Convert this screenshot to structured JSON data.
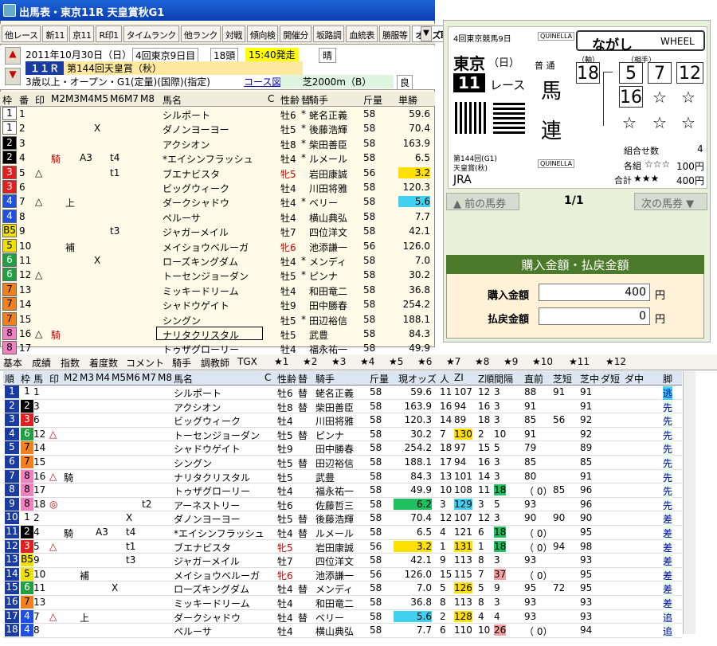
{
  "window": {
    "title": "出馬表・東京11R 天皇賞秋G1"
  },
  "toolbar": [
    "他レース",
    "新11",
    "京11",
    "R印1",
    "タイムランク",
    "他ランク",
    "対戦",
    "傾向検",
    "開催分",
    "坂路調",
    "血統表",
    "勝服等",
    "オッズ取"
  ],
  "race": {
    "date": "2011年10月30日（日）",
    "meeting": "4回東京9日目",
    "heads": "18頭",
    "post_time": "15:40発走",
    "weather": "晴",
    "race_no": "１１Ｒ",
    "name": "第144回天皇賞（秋）",
    "conditions": "3歳以上・オープン・G1(定量)(国際)(指定)",
    "course_label": "コース図",
    "course": "芝2000m（B）",
    "going": "良"
  },
  "entry_headers": [
    "枠",
    "番",
    "印",
    "M2",
    "M3",
    "M4",
    "M5",
    "M6",
    "M7",
    "M8",
    "馬名",
    "C",
    "性齢",
    "替",
    "騎手",
    "斤量",
    "単勝"
  ],
  "entries": [
    [
      "1",
      "1",
      "",
      "",
      "",
      "",
      "",
      "",
      "",
      "",
      "シルポート",
      "",
      "牡6",
      "*",
      "蛯名正義",
      "58",
      "59.6"
    ],
    [
      "1",
      "2",
      "",
      "",
      "",
      "",
      "X",
      "",
      "",
      "",
      "ダノンヨーヨー",
      "",
      "牡5",
      "*",
      "後藤浩輝",
      "58",
      "70.4"
    ],
    [
      "2",
      "3",
      "",
      "",
      "",
      "",
      "",
      "",
      "",
      "",
      "アクシオン",
      "",
      "牡8",
      "*",
      "柴田善臣",
      "58",
      "163.9"
    ],
    [
      "2",
      "4",
      "",
      "騎",
      "",
      "A3",
      "",
      "t4",
      "",
      "",
      "*エイシンフラッシュ",
      "",
      "牡4",
      "*",
      "ルメール",
      "58",
      "6.5"
    ],
    [
      "3",
      "5",
      "△",
      "",
      "",
      "",
      "",
      "t1",
      "",
      "",
      "ブエナビスタ",
      "",
      "牝5",
      "",
      "岩田康誠",
      "56",
      "3.2"
    ],
    [
      "3",
      "6",
      "",
      "",
      "",
      "",
      "",
      "",
      "",
      "",
      "ビッグウィーク",
      "",
      "牡4",
      "",
      "川田将雅",
      "58",
      "120.3"
    ],
    [
      "4",
      "7",
      "△",
      "",
      "上",
      "",
      "",
      "",
      "",
      "",
      "ダークシャドウ",
      "",
      "牡4",
      "*",
      "ベリー",
      "58",
      "5.6"
    ],
    [
      "4",
      "8",
      "",
      "",
      "",
      "",
      "",
      "",
      "",
      "",
      "ペルーサ",
      "",
      "牡4",
      "",
      "横山典弘",
      "58",
      "7.7"
    ],
    [
      "B5",
      "9",
      "",
      "",
      "",
      "",
      "",
      "t3",
      "",
      "",
      "ジャガーメイル",
      "",
      "牡7",
      "",
      "四位洋文",
      "58",
      "42.1"
    ],
    [
      "5",
      "10",
      "",
      "",
      "補",
      "",
      "",
      "",
      "",
      "",
      "メイショウベルーガ",
      "",
      "牝6",
      "",
      "池添謙一",
      "56",
      "126.0"
    ],
    [
      "6",
      "11",
      "",
      "",
      "",
      "",
      "X",
      "",
      "",
      "",
      "ローズキングダム",
      "",
      "牡4",
      "*",
      "メンディ",
      "58",
      "7.0"
    ],
    [
      "6",
      "12",
      "△",
      "",
      "",
      "",
      "",
      "",
      "",
      "",
      "トーセンジョーダン",
      "",
      "牡5",
      "*",
      "ピンナ",
      "58",
      "30.2"
    ],
    [
      "7",
      "13",
      "",
      "",
      "",
      "",
      "",
      "",
      "",
      "",
      "ミッキードリーム",
      "",
      "牡4",
      "",
      "和田竜二",
      "58",
      "36.8"
    ],
    [
      "7",
      "14",
      "",
      "",
      "",
      "",
      "",
      "",
      "",
      "",
      "シャドウゲイト",
      "",
      "牡9",
      "",
      "田中勝春",
      "58",
      "254.2"
    ],
    [
      "7",
      "15",
      "",
      "",
      "",
      "",
      "",
      "",
      "",
      "",
      "シングン",
      "",
      "牡5",
      "*",
      "田辺裕信",
      "58",
      "188.1"
    ],
    [
      "8",
      "16",
      "△",
      "騎",
      "",
      "",
      "",
      "",
      "",
      "",
      "ナリタクリスタル",
      "",
      "牡5",
      "",
      "武豊",
      "58",
      "84.3"
    ],
    [
      "8",
      "17",
      "",
      "",
      "",
      "",
      "",
      "",
      "",
      "",
      "トゥザグローリー",
      "",
      "牡4",
      "",
      "福永祐一",
      "58",
      "49.9"
    ],
    [
      "8",
      "18",
      "◎",
      "",
      "",
      "",
      "",
      "t2",
      "",
      "",
      "アーネストリー",
      "",
      "牡6",
      "",
      "佐藤哲三",
      "58",
      "6.2"
    ]
  ],
  "ticket": {
    "meeting": "4回東京競馬9日",
    "kind_top": "QUINELLA",
    "mode": "ながし",
    "mode_en": "WHEEL",
    "venue": "東京",
    "day": "（日）",
    "race_no": "11",
    "race_word": "レース",
    "type_small": "普 通",
    "type1": "馬",
    "type2": "連",
    "axis_label": "（軸）",
    "partner_label": "（相手）",
    "axis": "18",
    "partners": [
      "5",
      "7",
      "12",
      "16"
    ],
    "stars": [
      "☆",
      "☆",
      "☆",
      "☆",
      "☆"
    ],
    "race_small1": "第144回(G1)",
    "race_small2": "天皇賞(秋)",
    "jra": "JRA",
    "kind_bottom": "QUINELLA",
    "combos_label": "組合せ数",
    "combos": "4",
    "each_label": "各組",
    "each_stars": "☆☆☆",
    "each_amount": "100円",
    "total_label": "合計",
    "total_stars": "★★★",
    "total_amount": "400円"
  },
  "nav": {
    "prev": "前の馬券",
    "page": "1/1",
    "next": "次の馬券"
  },
  "payment": {
    "header": "購入金額・払戻金額",
    "buy_label": "購入金額",
    "buy_value": "400",
    "pay_label": "払戻金額",
    "pay_value": "0",
    "yen": "円"
  },
  "tabs": [
    "基本",
    "成績",
    "指数",
    "着度数",
    "コメント",
    "騎手",
    "調教師",
    "TGX",
    "★1",
    "★2",
    "★3",
    "★4",
    "★5",
    "★6",
    "★7",
    "★8",
    "★9",
    "★10",
    "★11",
    "★12"
  ],
  "bottom_headers": [
    "順",
    "枠",
    "馬",
    "印",
    "M2",
    "M3",
    "M4",
    "M5",
    "M6",
    "M7",
    "M8",
    "馬名",
    "C",
    "性齢",
    "替",
    "騎手",
    "斤量",
    "現オッズ",
    "人",
    "ZI",
    "Z順",
    "間隔",
    "直前",
    "芝短",
    "芝中",
    "ダ短",
    "ダ中",
    "脚"
  ],
  "bottom_rows": [
    [
      "1",
      "1",
      "1",
      "",
      "",
      "",
      "",
      "",
      "",
      "",
      "",
      "シルポート",
      "",
      "牡6",
      "替",
      "蛯名正義",
      "58",
      "59.6",
      "11",
      "107",
      "12",
      "3",
      "88",
      "91",
      "91",
      "",
      "",
      "逃"
    ],
    [
      "2",
      "2",
      "3",
      "",
      "",
      "",
      "",
      "",
      "",
      "",
      "",
      "アクシオン",
      "",
      "牡8",
      "替",
      "柴田善臣",
      "58",
      "163.9",
      "16",
      "94",
      "16",
      "3",
      "91",
      "",
      "91",
      "",
      "",
      "先"
    ],
    [
      "3",
      "3",
      "6",
      "",
      "",
      "",
      "",
      "",
      "",
      "",
      "",
      "ビッグウィーク",
      "",
      "牡4",
      "",
      "川田将雅",
      "58",
      "120.3",
      "14",
      "89",
      "18",
      "3",
      "85",
      "56",
      "92",
      "",
      "",
      "先"
    ],
    [
      "4",
      "6",
      "12",
      "△",
      "",
      "",
      "",
      "",
      "",
      "",
      "",
      "トーセンジョーダン",
      "",
      "牡5",
      "替",
      "ピンナ",
      "58",
      "30.2",
      "7",
      "130",
      "2",
      "10",
      "91",
      "",
      "92",
      "",
      "",
      "先"
    ],
    [
      "5",
      "7",
      "14",
      "",
      "",
      "",
      "",
      "",
      "",
      "",
      "",
      "シャドウゲイト",
      "",
      "牡9",
      "",
      "田中勝春",
      "58",
      "254.2",
      "18",
      "97",
      "15",
      "5",
      "79",
      "",
      "89",
      "",
      "",
      "先"
    ],
    [
      "6",
      "7",
      "15",
      "",
      "",
      "",
      "",
      "",
      "",
      "",
      "",
      "シングン",
      "",
      "牡5",
      "替",
      "田辺裕信",
      "58",
      "188.1",
      "17",
      "94",
      "16",
      "3",
      "85",
      "",
      "85",
      "",
      "",
      "先"
    ],
    [
      "7",
      "8",
      "16",
      "△",
      "騎",
      "",
      "",
      "",
      "",
      "",
      "",
      "ナリタクリスタル",
      "",
      "牡5",
      "",
      "武豊",
      "58",
      "84.3",
      "13",
      "101",
      "14",
      "3",
      "80",
      "",
      "91",
      "",
      "",
      "先"
    ],
    [
      "8",
      "8",
      "17",
      "",
      "",
      "",
      "",
      "",
      "",
      "",
      "",
      "トゥザグローリー",
      "",
      "牡4",
      "",
      "福永祐一",
      "58",
      "49.9",
      "10",
      "108",
      "11",
      "18",
      "（ 0）",
      "85",
      "96",
      "",
      "",
      "先"
    ],
    [
      "9",
      "8",
      "18",
      "◎",
      "",
      "",
      "",
      "",
      "",
      "t2",
      "",
      "アーネストリー",
      "",
      "牡6",
      "",
      "佐藤哲三",
      "58",
      "6.2",
      "3",
      "129",
      "3",
      "5",
      "93",
      "",
      "96",
      "",
      "",
      "先"
    ],
    [
      "10",
      "1",
      "2",
      "",
      "",
      "",
      "",
      "",
      "X",
      "",
      "",
      "ダノンヨーヨー",
      "",
      "牡5",
      "替",
      "後藤浩輝",
      "58",
      "70.4",
      "12",
      "107",
      "12",
      "3",
      "90",
      "90",
      "90",
      "",
      "",
      "差"
    ],
    [
      "11",
      "2",
      "4",
      "",
      "騎",
      "",
      "A3",
      "",
      "t4",
      "",
      "",
      "*エイシンフラッシュ",
      "",
      "牡4",
      "替",
      "ルメール",
      "58",
      "6.5",
      "4",
      "121",
      "6",
      "18",
      "（ 0）",
      "",
      "95",
      "",
      "",
      "差"
    ],
    [
      "12",
      "3",
      "5",
      "△",
      "",
      "",
      "",
      "",
      "t1",
      "",
      "",
      "ブエナビスタ",
      "",
      "牝5",
      "",
      "岩田康誠",
      "56",
      "3.2",
      "1",
      "131",
      "1",
      "18",
      "（ 0）",
      "94",
      "98",
      "",
      "",
      "差"
    ],
    [
      "13",
      "B5",
      "9",
      "",
      "",
      "",
      "",
      "",
      "t3",
      "",
      "",
      "ジャガーメイル",
      "",
      "牡7",
      "",
      "四位洋文",
      "58",
      "42.1",
      "9",
      "113",
      "8",
      "3",
      "93",
      "",
      "93",
      "",
      "",
      "差"
    ],
    [
      "14",
      "5",
      "10",
      "",
      "",
      "補",
      "",
      "",
      "",
      "",
      "",
      "メイショウベルーガ",
      "",
      "牝6",
      "",
      "池添謙一",
      "56",
      "126.0",
      "15",
      "115",
      "7",
      "37",
      "（ 0）",
      "",
      "95",
      "",
      "",
      "差"
    ],
    [
      "15",
      "6",
      "11",
      "",
      "",
      "",
      "",
      "X",
      "",
      "",
      "",
      "ローズキングダム",
      "",
      "牡4",
      "替",
      "メンディ",
      "58",
      "7.0",
      "5",
      "126",
      "5",
      "9",
      "95",
      "72",
      "95",
      "",
      "",
      "差"
    ],
    [
      "16",
      "7",
      "13",
      "",
      "",
      "",
      "",
      "",
      "",
      "",
      "",
      "ミッキードリーム",
      "",
      "牡4",
      "",
      "和田竜二",
      "58",
      "36.8",
      "8",
      "113",
      "8",
      "3",
      "93",
      "",
      "93",
      "",
      "",
      "差"
    ],
    [
      "17",
      "4",
      "7",
      "△",
      "",
      "上",
      "",
      "",
      "",
      "",
      "",
      "ダークシャドウ",
      "",
      "牡4",
      "替",
      "ベリー",
      "58",
      "5.6",
      "2",
      "128",
      "4",
      "4",
      "93",
      "",
      "93",
      "",
      "",
      "追"
    ],
    [
      "18",
      "4",
      "8",
      "",
      "",
      "",
      "",
      "",
      "",
      "",
      "",
      "ペルーサ",
      "",
      "牡4",
      "",
      "横山典弘",
      "58",
      "7.7",
      "6",
      "110",
      "10",
      "26",
      "（ 0）",
      "",
      "94",
      "",
      "",
      "追"
    ]
  ],
  "colors": {
    "w1": "#ffffff",
    "w2": "#000000",
    "w3": "#e02020",
    "w4": "#2050e0",
    "w5": "#f0e000",
    "w6": "#20a040",
    "w7": "#f08020",
    "w8": "#f080c0"
  }
}
